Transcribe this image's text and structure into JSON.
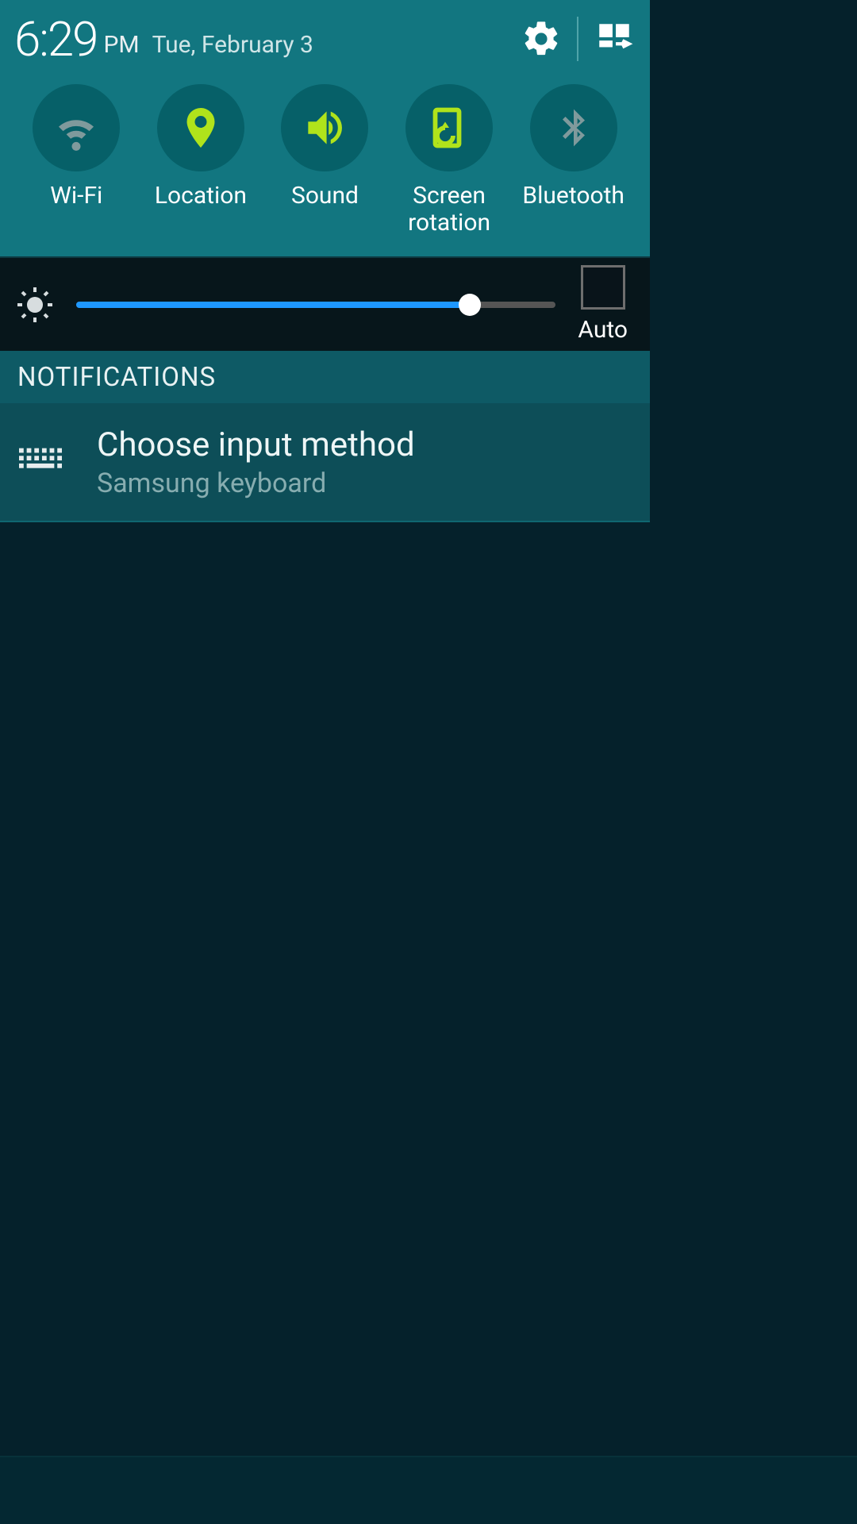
{
  "header": {
    "time": "6:29",
    "ampm": "PM",
    "date": "Tue, February 3"
  },
  "toggles": {
    "wifi": {
      "label": "Wi-Fi",
      "active": false
    },
    "location": {
      "label": "Location",
      "active": true
    },
    "sound": {
      "label": "Sound",
      "active": true
    },
    "rotation": {
      "label": "Screen\nrotation",
      "active": true
    },
    "bluetooth": {
      "label": "Bluetooth",
      "active": false
    }
  },
  "brightness": {
    "percent": 82,
    "auto_label": "Auto",
    "auto_checked": false
  },
  "sections": {
    "notifications_title": "NOTIFICATIONS"
  },
  "notifications": [
    {
      "title": "Choose input method",
      "subtitle": "Samsung keyboard",
      "icon": "keyboard-icon"
    }
  ],
  "colors": {
    "accent_active": "#b0e31b",
    "accent_inactive": "#7f9a9c",
    "circle_bg": "#066068"
  }
}
